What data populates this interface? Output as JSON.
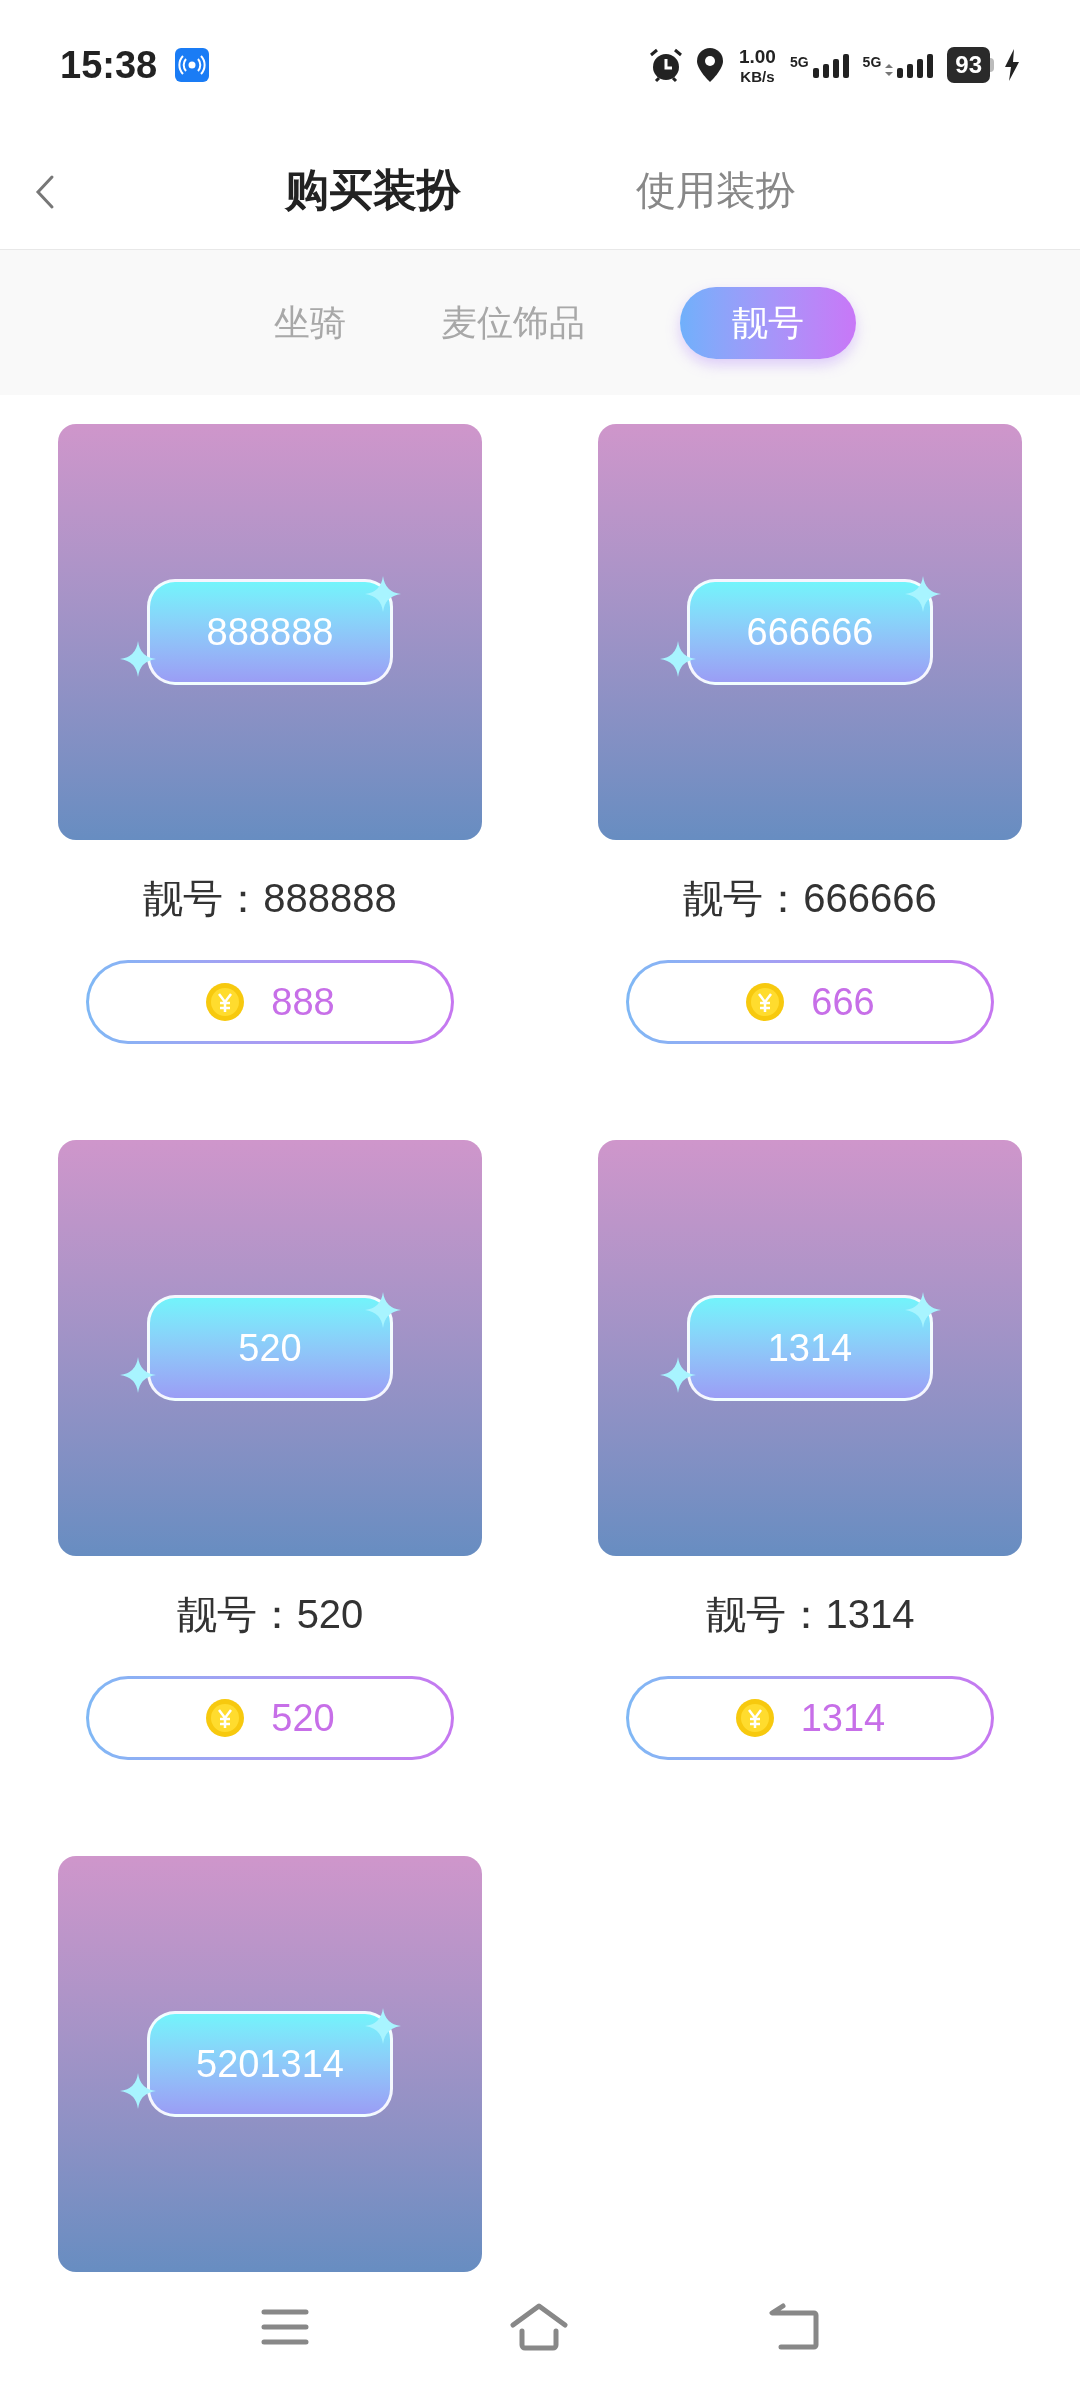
{
  "status_bar": {
    "time": "15:38",
    "net_speed_value": "1.00",
    "net_speed_unit": "KB/s",
    "sim1": "5G",
    "sim2": "5G",
    "battery": "93",
    "charging": true
  },
  "header": {
    "tabs": [
      {
        "label": "购买装扮",
        "selected": true
      },
      {
        "label": "使用装扮",
        "selected": false
      }
    ]
  },
  "categories": [
    {
      "label": "坐骑",
      "selected": false
    },
    {
      "label": "麦位饰品",
      "selected": false
    },
    {
      "label": "靓号",
      "selected": true
    }
  ],
  "items": [
    {
      "badge_text": "888888",
      "title": "靓号：888888",
      "price": "888"
    },
    {
      "badge_text": "666666",
      "title": "靓号：666666",
      "price": "666"
    },
    {
      "badge_text": "520",
      "title": "靓号：520",
      "price": "520"
    },
    {
      "badge_text": "1314",
      "title": "靓号：1314",
      "price": "1314"
    },
    {
      "badge_text": "5201314"
    }
  ]
}
